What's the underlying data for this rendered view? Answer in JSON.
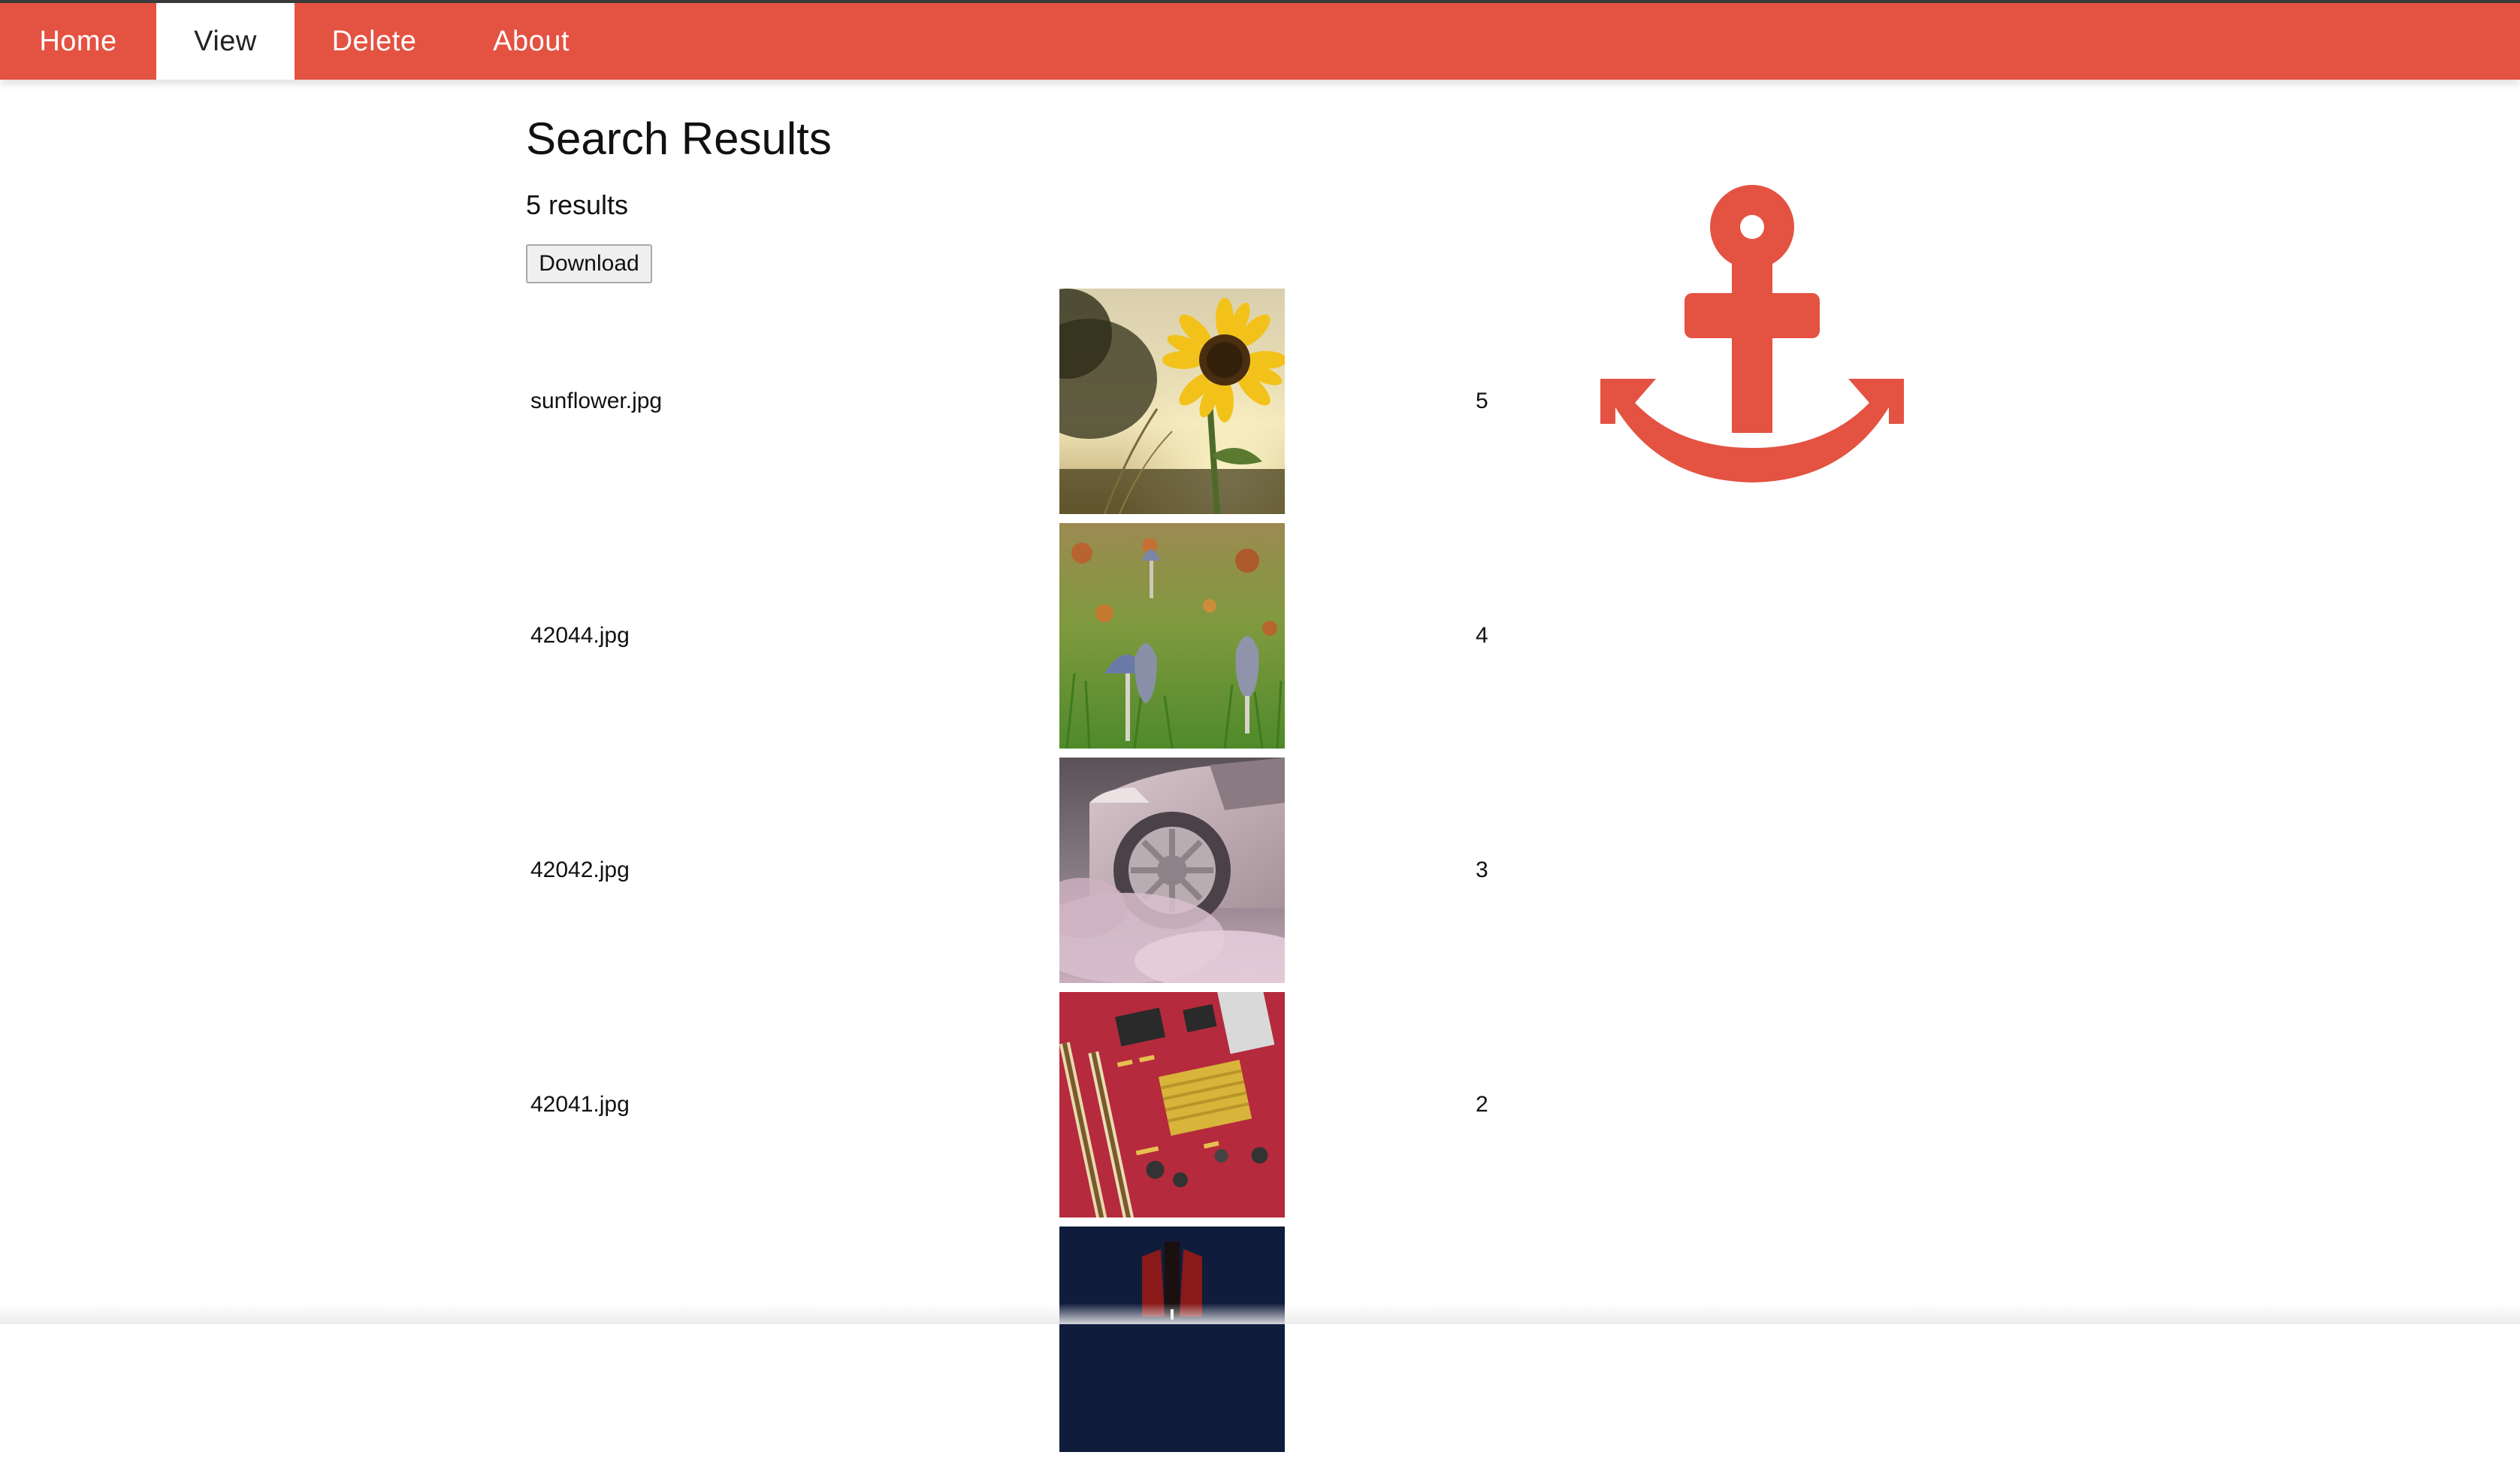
{
  "nav": {
    "items": [
      {
        "label": "Home",
        "active": false
      },
      {
        "label": "View",
        "active": true
      },
      {
        "label": "Delete",
        "active": false
      },
      {
        "label": "About",
        "active": false
      }
    ],
    "bar_color": "#e45242"
  },
  "main": {
    "title": "Search Results",
    "result_count": "5 results",
    "download_label": "Download"
  },
  "results": [
    {
      "filename": "sunflower.jpg",
      "rank": "5",
      "thumb": "sunflower"
    },
    {
      "filename": "42044.jpg",
      "rank": "4",
      "thumb": "mushrooms"
    },
    {
      "filename": "42042.jpg",
      "rank": "3",
      "thumb": "car-tire-smoke"
    },
    {
      "filename": "42041.jpg",
      "rank": "2",
      "thumb": "circuit-board"
    },
    {
      "filename": "",
      "rank": "",
      "thumb": "dark-red-object"
    }
  ],
  "logo": {
    "icon": "anchor-icon",
    "color": "#e45242"
  }
}
